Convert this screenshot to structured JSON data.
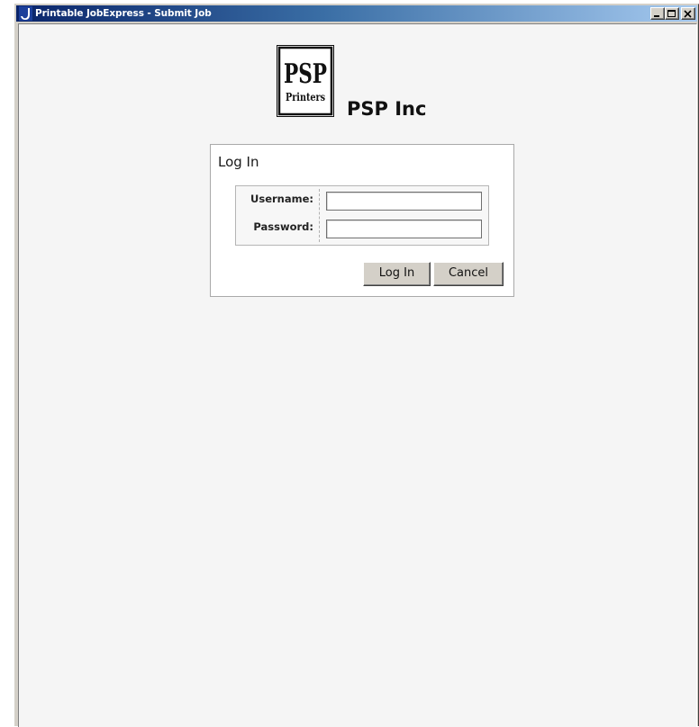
{
  "window": {
    "title": "Printable JobExpress - Submit Job",
    "controls": {
      "minimize_icon": "minimize-icon",
      "maximize_icon": "maximize-icon",
      "close_icon": "close-icon"
    }
  },
  "brand": {
    "logo_line1": "PSP",
    "logo_line2": "Printers",
    "company_name": "PSP Inc"
  },
  "login": {
    "title": "Log In",
    "username_label": "Username:",
    "username_value": "",
    "password_label": "Password:",
    "password_value": "",
    "login_button": "Log In",
    "cancel_button": "Cancel"
  },
  "colors": {
    "titlebar_start": "#0a246a",
    "titlebar_end": "#a6caf0",
    "client_bg": "#f5f5f5",
    "button_face": "#d4d0c8"
  }
}
